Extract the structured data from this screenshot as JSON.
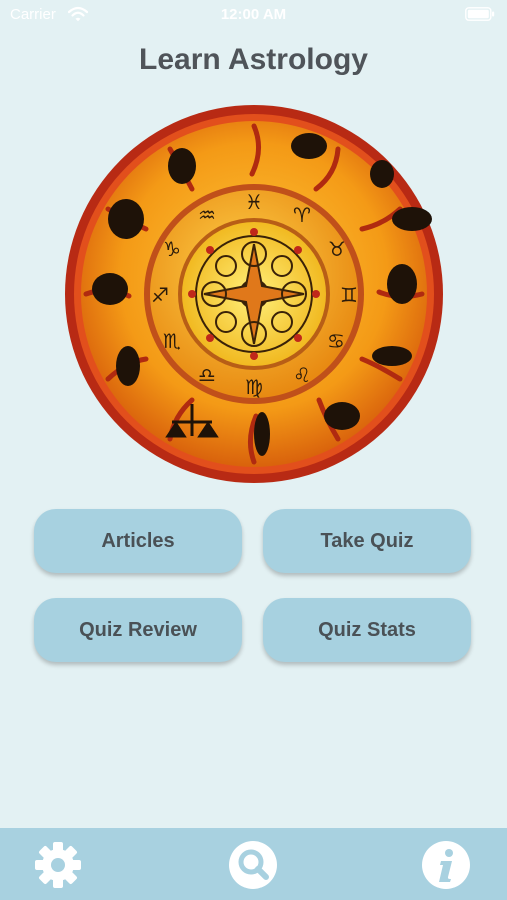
{
  "status_bar": {
    "carrier": "Carrier",
    "time": "12:00 AM",
    "wifi_icon": "wifi-icon",
    "battery_icon": "battery-icon"
  },
  "header": {
    "title": "Learn Astrology"
  },
  "wheel": {
    "image": "zodiac-wheel",
    "colors": {
      "outer_ring": "#c8321a",
      "band": "#f19a14",
      "center": "#f6d23a"
    }
  },
  "menu": {
    "articles_label": "Articles",
    "take_quiz_label": "Take Quiz",
    "quiz_review_label": "Quiz Review",
    "quiz_stats_label": "Quiz Stats",
    "button_color": "#a7d1e0"
  },
  "tab_bar": {
    "settings_icon": "gear-icon",
    "search_icon": "search-icon",
    "info_icon": "info-icon",
    "background_color": "#a8d1e0"
  }
}
